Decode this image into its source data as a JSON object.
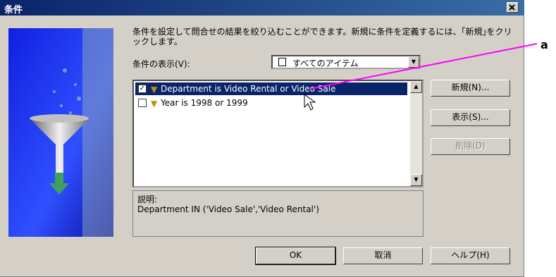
{
  "window": {
    "title": "条件"
  },
  "intro_text": "条件を設定して問合せの結果を絞り込むことができます。新規に条件を定義するには、｢新規｣をクリックします。",
  "view_label": "条件の表示(V):",
  "view_select": {
    "value": "すべてのアイテム"
  },
  "conditions": [
    {
      "checked": true,
      "text": "Department is Video Rental or Video Sale",
      "selected": true
    },
    {
      "checked": false,
      "text": "Year is 1998 or 1999",
      "selected": false
    }
  ],
  "description": {
    "label": "説明:",
    "text": "Department IN ('Video Sale','Video Rental')"
  },
  "buttons": {
    "new": "新規(N)...",
    "show": "表示(S)...",
    "delete": "削除(D)",
    "ok": "OK",
    "cancel": "取消",
    "help": "ヘルプ(H)"
  },
  "annotation": {
    "label": "a",
    "color": "#ff00ff"
  }
}
